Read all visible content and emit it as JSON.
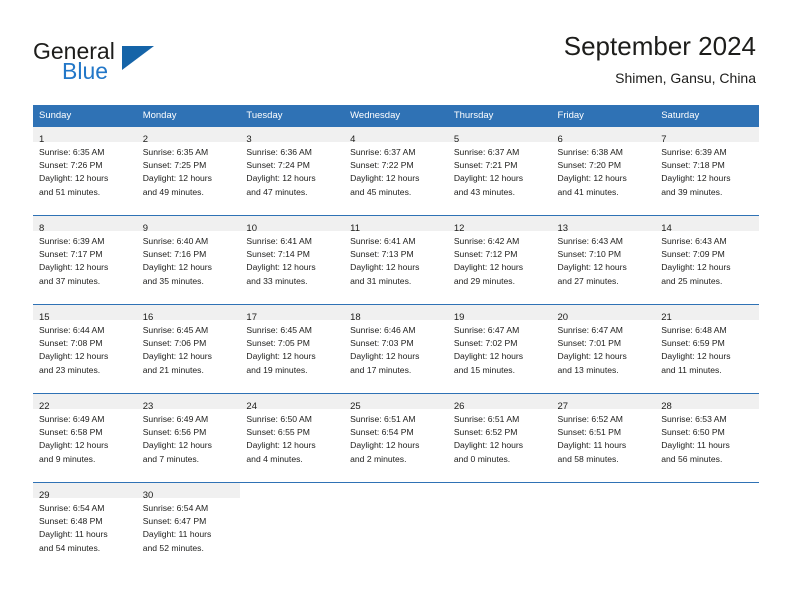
{
  "brand": {
    "name_primary": "General",
    "name_secondary": "Blue",
    "triangle_icon": "triangle-icon",
    "accent_color": "#2f72b5"
  },
  "header": {
    "title": "September 2024",
    "subtitle": "Shimen, Gansu, China"
  },
  "calendar": {
    "weekday_headers": [
      "Sunday",
      "Monday",
      "Tuesday",
      "Wednesday",
      "Thursday",
      "Friday",
      "Saturday"
    ],
    "weeks": [
      [
        {
          "day": "1",
          "sunrise": "Sunrise: 6:35 AM",
          "sunset": "Sunset: 7:26 PM",
          "daylight_1": "Daylight: 12 hours",
          "daylight_2": "and 51 minutes."
        },
        {
          "day": "2",
          "sunrise": "Sunrise: 6:35 AM",
          "sunset": "Sunset: 7:25 PM",
          "daylight_1": "Daylight: 12 hours",
          "daylight_2": "and 49 minutes."
        },
        {
          "day": "3",
          "sunrise": "Sunrise: 6:36 AM",
          "sunset": "Sunset: 7:24 PM",
          "daylight_1": "Daylight: 12 hours",
          "daylight_2": "and 47 minutes."
        },
        {
          "day": "4",
          "sunrise": "Sunrise: 6:37 AM",
          "sunset": "Sunset: 7:22 PM",
          "daylight_1": "Daylight: 12 hours",
          "daylight_2": "and 45 minutes."
        },
        {
          "day": "5",
          "sunrise": "Sunrise: 6:37 AM",
          "sunset": "Sunset: 7:21 PM",
          "daylight_1": "Daylight: 12 hours",
          "daylight_2": "and 43 minutes."
        },
        {
          "day": "6",
          "sunrise": "Sunrise: 6:38 AM",
          "sunset": "Sunset: 7:20 PM",
          "daylight_1": "Daylight: 12 hours",
          "daylight_2": "and 41 minutes."
        },
        {
          "day": "7",
          "sunrise": "Sunrise: 6:39 AM",
          "sunset": "Sunset: 7:18 PM",
          "daylight_1": "Daylight: 12 hours",
          "daylight_2": "and 39 minutes."
        }
      ],
      [
        {
          "day": "8",
          "sunrise": "Sunrise: 6:39 AM",
          "sunset": "Sunset: 7:17 PM",
          "daylight_1": "Daylight: 12 hours",
          "daylight_2": "and 37 minutes."
        },
        {
          "day": "9",
          "sunrise": "Sunrise: 6:40 AM",
          "sunset": "Sunset: 7:16 PM",
          "daylight_1": "Daylight: 12 hours",
          "daylight_2": "and 35 minutes."
        },
        {
          "day": "10",
          "sunrise": "Sunrise: 6:41 AM",
          "sunset": "Sunset: 7:14 PM",
          "daylight_1": "Daylight: 12 hours",
          "daylight_2": "and 33 minutes."
        },
        {
          "day": "11",
          "sunrise": "Sunrise: 6:41 AM",
          "sunset": "Sunset: 7:13 PM",
          "daylight_1": "Daylight: 12 hours",
          "daylight_2": "and 31 minutes."
        },
        {
          "day": "12",
          "sunrise": "Sunrise: 6:42 AM",
          "sunset": "Sunset: 7:12 PM",
          "daylight_1": "Daylight: 12 hours",
          "daylight_2": "and 29 minutes."
        },
        {
          "day": "13",
          "sunrise": "Sunrise: 6:43 AM",
          "sunset": "Sunset: 7:10 PM",
          "daylight_1": "Daylight: 12 hours",
          "daylight_2": "and 27 minutes."
        },
        {
          "day": "14",
          "sunrise": "Sunrise: 6:43 AM",
          "sunset": "Sunset: 7:09 PM",
          "daylight_1": "Daylight: 12 hours",
          "daylight_2": "and 25 minutes."
        }
      ],
      [
        {
          "day": "15",
          "sunrise": "Sunrise: 6:44 AM",
          "sunset": "Sunset: 7:08 PM",
          "daylight_1": "Daylight: 12 hours",
          "daylight_2": "and 23 minutes."
        },
        {
          "day": "16",
          "sunrise": "Sunrise: 6:45 AM",
          "sunset": "Sunset: 7:06 PM",
          "daylight_1": "Daylight: 12 hours",
          "daylight_2": "and 21 minutes."
        },
        {
          "day": "17",
          "sunrise": "Sunrise: 6:45 AM",
          "sunset": "Sunset: 7:05 PM",
          "daylight_1": "Daylight: 12 hours",
          "daylight_2": "and 19 minutes."
        },
        {
          "day": "18",
          "sunrise": "Sunrise: 6:46 AM",
          "sunset": "Sunset: 7:03 PM",
          "daylight_1": "Daylight: 12 hours",
          "daylight_2": "and 17 minutes."
        },
        {
          "day": "19",
          "sunrise": "Sunrise: 6:47 AM",
          "sunset": "Sunset: 7:02 PM",
          "daylight_1": "Daylight: 12 hours",
          "daylight_2": "and 15 minutes."
        },
        {
          "day": "20",
          "sunrise": "Sunrise: 6:47 AM",
          "sunset": "Sunset: 7:01 PM",
          "daylight_1": "Daylight: 12 hours",
          "daylight_2": "and 13 minutes."
        },
        {
          "day": "21",
          "sunrise": "Sunrise: 6:48 AM",
          "sunset": "Sunset: 6:59 PM",
          "daylight_1": "Daylight: 12 hours",
          "daylight_2": "and 11 minutes."
        }
      ],
      [
        {
          "day": "22",
          "sunrise": "Sunrise: 6:49 AM",
          "sunset": "Sunset: 6:58 PM",
          "daylight_1": "Daylight: 12 hours",
          "daylight_2": "and 9 minutes."
        },
        {
          "day": "23",
          "sunrise": "Sunrise: 6:49 AM",
          "sunset": "Sunset: 6:56 PM",
          "daylight_1": "Daylight: 12 hours",
          "daylight_2": "and 7 minutes."
        },
        {
          "day": "24",
          "sunrise": "Sunrise: 6:50 AM",
          "sunset": "Sunset: 6:55 PM",
          "daylight_1": "Daylight: 12 hours",
          "daylight_2": "and 4 minutes."
        },
        {
          "day": "25",
          "sunrise": "Sunrise: 6:51 AM",
          "sunset": "Sunset: 6:54 PM",
          "daylight_1": "Daylight: 12 hours",
          "daylight_2": "and 2 minutes."
        },
        {
          "day": "26",
          "sunrise": "Sunrise: 6:51 AM",
          "sunset": "Sunset: 6:52 PM",
          "daylight_1": "Daylight: 12 hours",
          "daylight_2": "and 0 minutes."
        },
        {
          "day": "27",
          "sunrise": "Sunrise: 6:52 AM",
          "sunset": "Sunset: 6:51 PM",
          "daylight_1": "Daylight: 11 hours",
          "daylight_2": "and 58 minutes."
        },
        {
          "day": "28",
          "sunrise": "Sunrise: 6:53 AM",
          "sunset": "Sunset: 6:50 PM",
          "daylight_1": "Daylight: 11 hours",
          "daylight_2": "and 56 minutes."
        }
      ],
      [
        {
          "day": "29",
          "sunrise": "Sunrise: 6:54 AM",
          "sunset": "Sunset: 6:48 PM",
          "daylight_1": "Daylight: 11 hours",
          "daylight_2": "and 54 minutes."
        },
        {
          "day": "30",
          "sunrise": "Sunrise: 6:54 AM",
          "sunset": "Sunset: 6:47 PM",
          "daylight_1": "Daylight: 11 hours",
          "daylight_2": "and 52 minutes."
        },
        null,
        null,
        null,
        null,
        null
      ]
    ]
  }
}
